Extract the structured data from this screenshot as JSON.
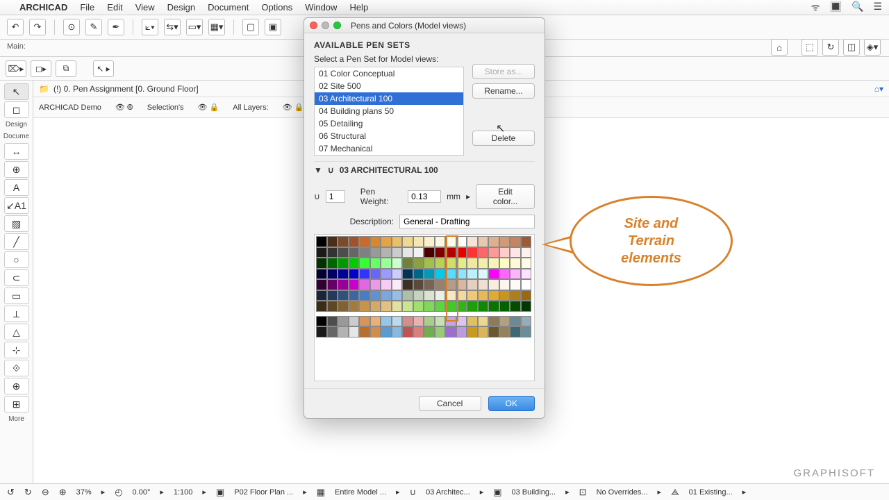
{
  "menubar": {
    "app": "ARCHICAD",
    "items": [
      "File",
      "Edit",
      "View",
      "Design",
      "Document",
      "Options",
      "Window",
      "Help"
    ]
  },
  "infobar": {
    "label": "Main:"
  },
  "path": {
    "text": "(!) 0. Pen Assignment [0. Ground Floor]"
  },
  "options_bar": {
    "demo": "ARCHICAD Demo",
    "sel": "Selection's",
    "layers": "All Layers:"
  },
  "toolbox": {
    "labels": [
      "Design",
      "Docume",
      "More"
    ]
  },
  "dialog": {
    "title": "Pens and Colors (Model views)",
    "header": "AVAILABLE PEN SETS",
    "prompt": "Select a Pen Set for Model views:",
    "sets": [
      "01 Color Conceptual",
      "02 Site 500",
      "03 Architectural 100",
      "04 Building plans 50",
      "05 Detailing",
      "06 Structural",
      "07 Mechanical"
    ],
    "selected_index": 2,
    "store_as": "Store as...",
    "rename": "Rename...",
    "delete": "Delete",
    "section": "03 ARCHITECTURAL 100",
    "pen_number": "1",
    "pen_weight_label": "Pen Weight:",
    "pen_weight": "0.13",
    "pen_unit": "mm",
    "edit_color": "Edit color...",
    "description_label": "Description:",
    "description": "General - Drafting",
    "cancel": "Cancel",
    "ok": "OK"
  },
  "callout": {
    "l1": "Site and",
    "l2": "Terrain",
    "l3": "elements"
  },
  "status": {
    "zoom": "37%",
    "angle": "0.00°",
    "scale": "1:100",
    "items": [
      "P02 Floor Plan ...",
      "Entire Model ...",
      "03 Architec...",
      "03 Building...",
      "No Overrides...",
      "01 Existing..."
    ]
  },
  "brand": "GRAPHISOFT",
  "palette_rows": [
    [
      "#000",
      "#4b2e1a",
      "#7b4a26",
      "#a0522d",
      "#c76a2b",
      "#d98829",
      "#e3a447",
      "#e8c068",
      "#efd98f",
      "#f5e7b2",
      "#f9f0cc",
      "#fbf6df",
      "#fefbea",
      "#fff",
      "#f6e3d3",
      "#eac8ad",
      "#ddb090",
      "#d19a76",
      "#c6855f",
      "#9d5a33"
    ],
    [
      "#1a1a1a",
      "#333",
      "#4d4d4d",
      "#666",
      "#808080",
      "#999",
      "#b3b3b3",
      "#ccc",
      "#e6e6e6",
      "#f2f2f2",
      "#4b0000",
      "#800000",
      "#b30000",
      "#e60000",
      "#ff3333",
      "#ff6666",
      "#ff9999",
      "#ffcccc",
      "#ffe5e5",
      "#fff0f0"
    ],
    [
      "#003300",
      "#006600",
      "#009900",
      "#00cc00",
      "#33ff33",
      "#66ff66",
      "#99ff99",
      "#ccffcc",
      "#708238",
      "#8ba141",
      "#a3c14a",
      "#b9d155",
      "#cde06a",
      "#e0ed89",
      "#efe8a0",
      "#f5eea8",
      "#f9f3b8",
      "#fefac8",
      "#fffbd8",
      "#fffde8"
    ],
    [
      "#000033",
      "#000066",
      "#000099",
      "#0000cc",
      "#3333ff",
      "#6666ff",
      "#9999ff",
      "#ccccff",
      "#003355",
      "#006688",
      "#0099bb",
      "#00ccee",
      "#55ddff",
      "#88e6ff",
      "#bbf0ff",
      "#ddf7ff",
      "#ff00ff",
      "#ff66ff",
      "#ffb3ff",
      "#ffe0ff"
    ],
    [
      "#330033",
      "#660066",
      "#990099",
      "#cc00cc",
      "#e366e3",
      "#ec99ec",
      "#f4ccf4",
      "#faeaf9",
      "#3a3025",
      "#594a3c",
      "#786454",
      "#97806e",
      "#b69b88",
      "#d5b7a2",
      "#e6d0bd",
      "#f0e0d1",
      "#f8ede0",
      "#fcf5ed",
      "#fefaf5",
      "#fff"
    ],
    [
      "#18253a",
      "#243a5d",
      "#30507f",
      "#3c66a2",
      "#4a7cc2",
      "#6291cf",
      "#7ba7db",
      "#94bde8",
      "#adc0a6",
      "#c4d3bd",
      "#d9e3d2",
      "#eaf0e5",
      "#f8e7c5",
      "#f3d89f",
      "#eec979",
      "#e8ba54",
      "#e2ab2f",
      "#c9941f",
      "#b07e18",
      "#986910"
    ],
    [
      "#3a2d18",
      "#5d4724",
      "#806131",
      "#a37b3e",
      "#c5954b",
      "#d3aa67",
      "#e0c084",
      "#dfe2a1",
      "#c7e68f",
      "#a0e070",
      "#7fd958",
      "#5fd340",
      "#41c928",
      "#2db714",
      "#1c9f09",
      "#108902",
      "#097400",
      "#066000",
      "#034d00",
      "#013a00"
    ]
  ],
  "palette_rows2": [
    [
      "#000",
      "#4d4d4d",
      "#999",
      "#ccc",
      "#d89459",
      "#e9b07a",
      "#97c7e8",
      "#bad9f0",
      "#d98c8c",
      "#e8b0b0",
      "#a8cf8a",
      "#c6e2b0",
      "#c5a6e0",
      "#dac5ec",
      "#e0c060",
      "#edd692",
      "#8c7a5a",
      "#b0a184",
      "#6a8a96",
      "#94adb8"
    ],
    [
      "#1a1a1a",
      "#666",
      "#b3b3b3",
      "#e6e6e6",
      "#b86f2e",
      "#d28d4b",
      "#5a9bd0",
      "#85b9e0",
      "#c05252",
      "#d88080",
      "#6fb04a",
      "#95cc76",
      "#9d6ed0",
      "#bc9be2",
      "#c99a20",
      "#dcb656",
      "#6b5730",
      "#94825e",
      "#3f6876",
      "#6a8e9c"
    ]
  ]
}
